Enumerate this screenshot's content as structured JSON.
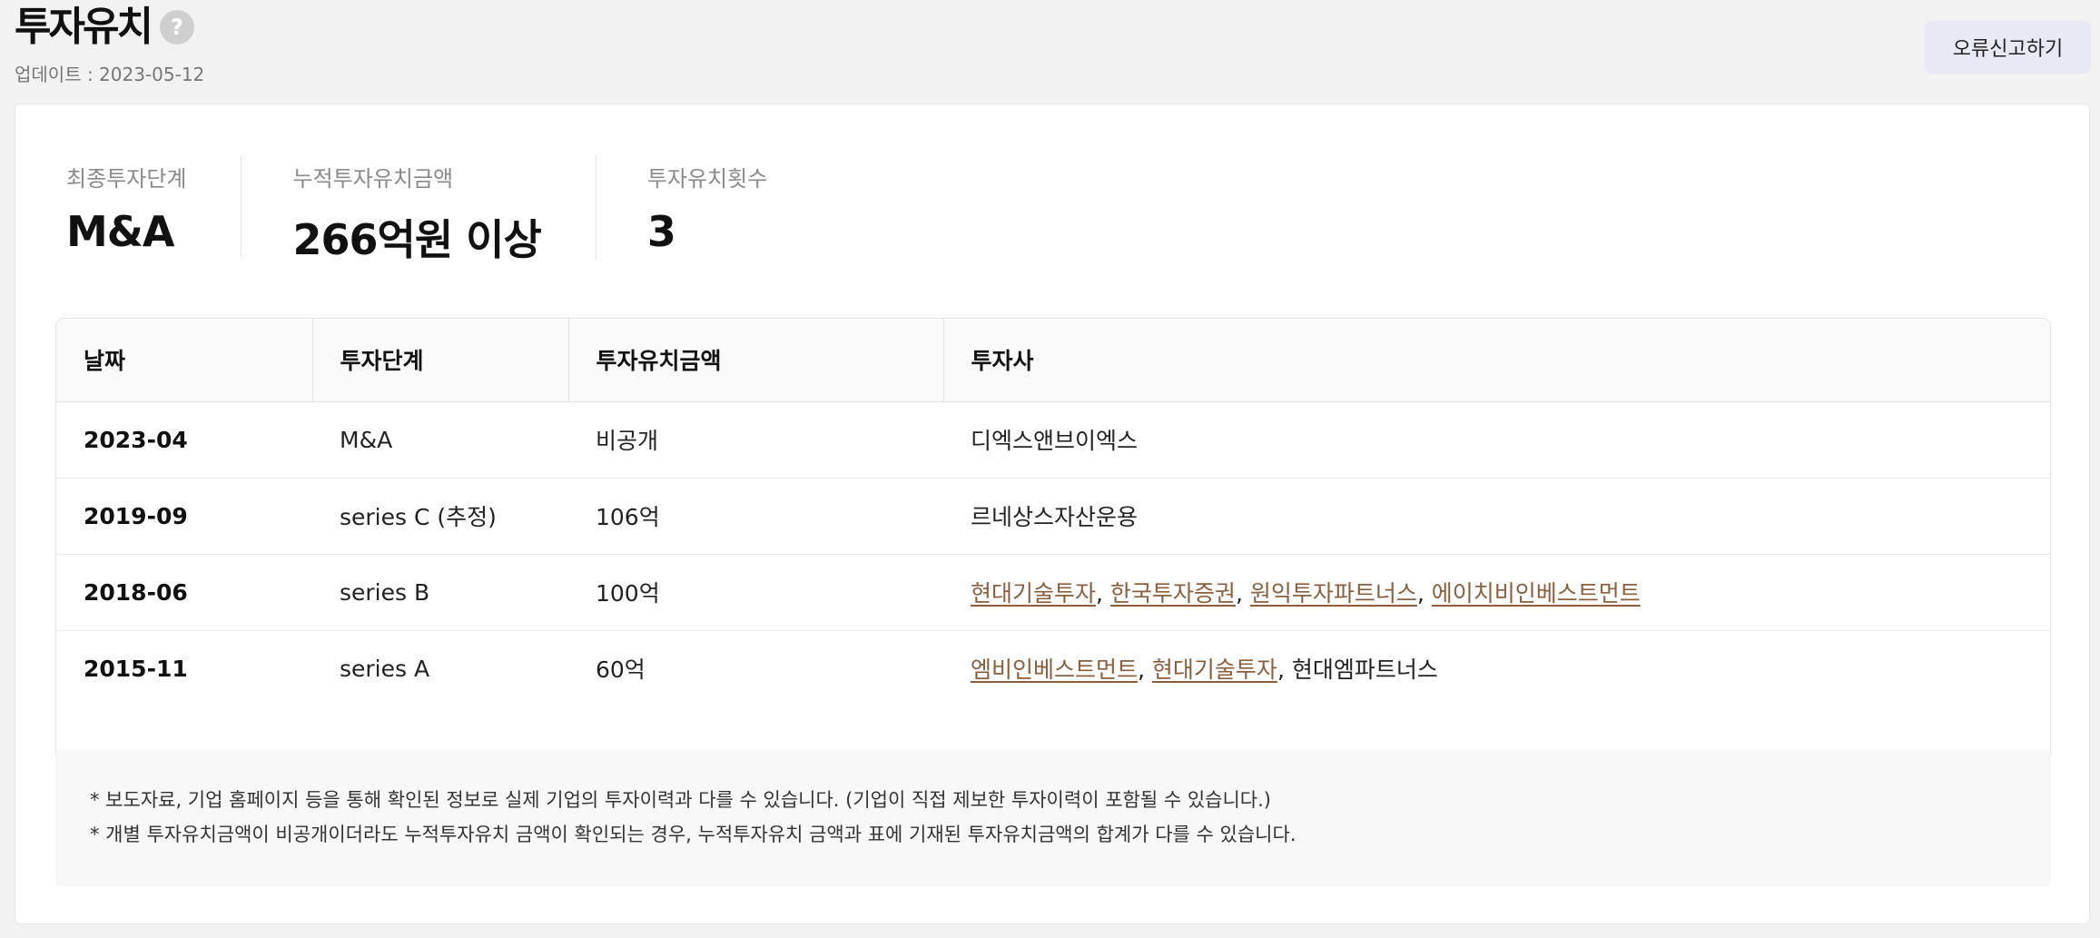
{
  "header": {
    "title": "투자유치",
    "help_symbol": "?",
    "update_label": "업데이트 : 2023-05-12",
    "report_button": "오류신고하기"
  },
  "summary": [
    {
      "label": "최종투자단계",
      "value": "M&A"
    },
    {
      "label": "누적투자유치금액",
      "value": "266억원 이상"
    },
    {
      "label": "투자유치횟수",
      "value": "3"
    }
  ],
  "table": {
    "headers": [
      "날짜",
      "투자단계",
      "투자유치금액",
      "투자사"
    ],
    "rows": [
      {
        "date": "2023-04",
        "stage": "M&A",
        "amount": "비공개",
        "investors": [
          {
            "name": "디엑스앤브이엑스",
            "link": false
          }
        ]
      },
      {
        "date": "2019-09",
        "stage": "series C (추정)",
        "amount": "106억",
        "investors": [
          {
            "name": "르네상스자산운용",
            "link": false
          }
        ]
      },
      {
        "date": "2018-06",
        "stage": "series B",
        "amount": "100억",
        "investors": [
          {
            "name": "현대기술투자",
            "link": true
          },
          {
            "name": "한국투자증권",
            "link": true
          },
          {
            "name": "원익투자파트너스",
            "link": true
          },
          {
            "name": "에이치비인베스트먼트",
            "link": true
          }
        ]
      },
      {
        "date": "2015-11",
        "stage": "series A",
        "amount": "60억",
        "investors": [
          {
            "name": "엠비인베스트먼트",
            "link": true
          },
          {
            "name": "현대기술투자",
            "link": true
          },
          {
            "name": "현대엠파트너스",
            "link": false
          }
        ]
      }
    ]
  },
  "notes": [
    "* 보도자료, 기업 홈페이지 등을 통해 확인된 정보로 실제 기업의 투자이력과 다를 수 있습니다. (기업이 직접 제보한 투자이력이 포함될 수 있습니다.)",
    "* 개별 투자유치금액이 비공개이더라도 누적투자유치 금액이 확인되는 경우, 누적투자유치 금액과 표에 기재된 투자유치금액의 합계가 다를 수 있습니다."
  ],
  "colors": {
    "link": "#8b5e3c",
    "report_button_bg": "#e9e9f6"
  }
}
